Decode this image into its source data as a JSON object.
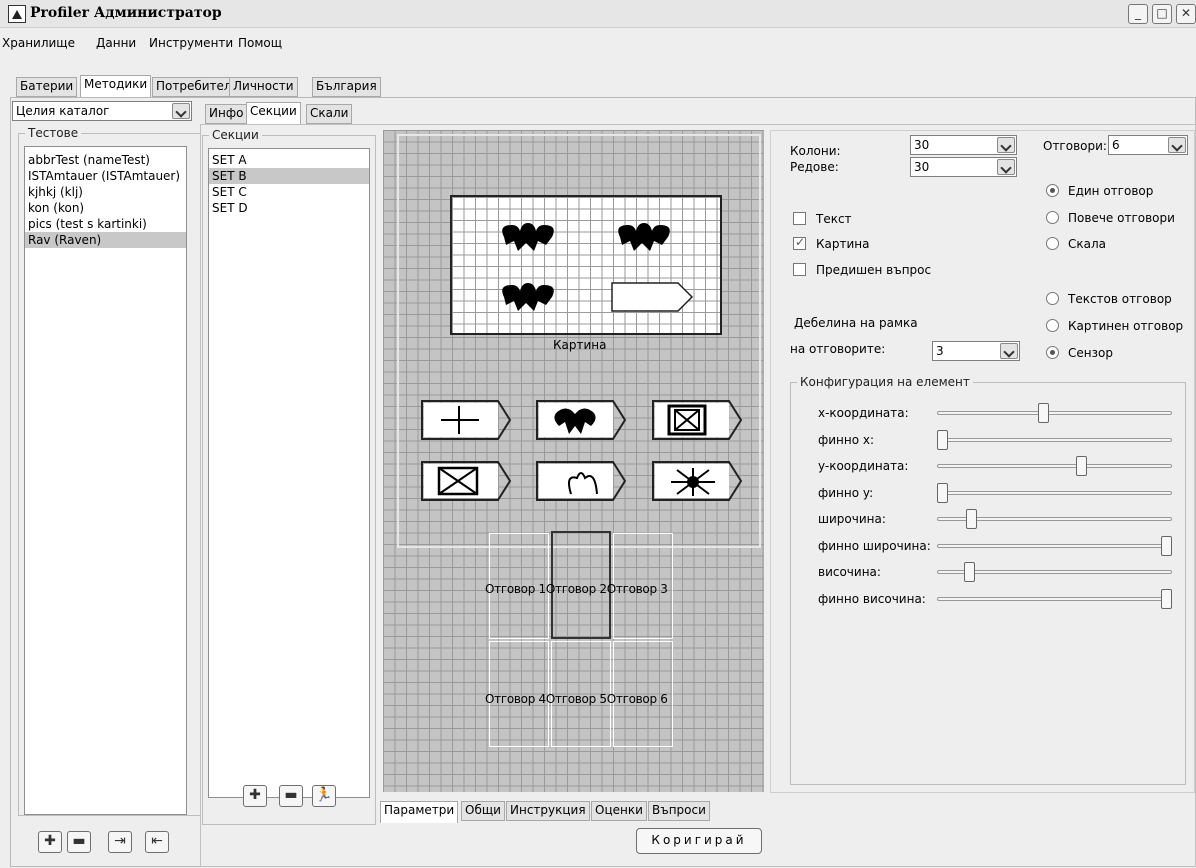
{
  "window": {
    "title": "Profiler Администратор"
  },
  "menu": [
    "Хранилище",
    "Данни",
    "Инструменти",
    "Помощ"
  ],
  "main_tabs": [
    "Батерии",
    "Методики",
    "Потребители",
    "Личности",
    "България"
  ],
  "left": {
    "catalog_select": "Целия каталог",
    "tests_label": "Тестове",
    "tests": [
      "abbrTest (nameTest)",
      "ISTAmtauer (ISTAmtauer)",
      "kjhkj (klj)",
      "kon (kon)",
      "pics (test s kartinki)",
      "Rav (Raven)"
    ]
  },
  "sub_tabs": [
    "Инфо",
    "Секции",
    "Скали"
  ],
  "sections": {
    "label": "Секции",
    "items": [
      "SET A",
      "SET B",
      "SET C",
      "SET D"
    ]
  },
  "canvas": {
    "picture_label": "Картина",
    "answers": [
      "Отговор 1",
      "Отговор 2",
      "Отговор 3",
      "Отговор 4",
      "Отговор 5",
      "Отговор 6"
    ]
  },
  "bottom_tabs": [
    "Параметри",
    "Общи",
    "Инструкция",
    "Оценки",
    "Въпроси"
  ],
  "right": {
    "columns_label": "Колони:",
    "columns_value": "30",
    "rows_label": "Редове:",
    "rows_value": "30",
    "answers_label": "Отговори:",
    "answers_value": "6",
    "single_answer": "Един отговор",
    "multi_answers": "Повече отговори",
    "scale": "Скала",
    "text_cb": "Текст",
    "picture_cb": "Картина",
    "prev_question_cb": "Предишен въпрос",
    "text_answer": "Текстов отговор",
    "picture_answer": "Картинен отговор",
    "sensor": "Сензор",
    "border_label_1": "Дебелина на рамка",
    "border_label_2": "на отговорите:",
    "border_value": "3",
    "config_label": "Конфигурация на елемент",
    "sliders": [
      {
        "label": "x-координата:",
        "value": 0.45
      },
      {
        "label": "финно x:",
        "value": 0.0
      },
      {
        "label": "y-координата:",
        "value": 0.62
      },
      {
        "label": "финно y:",
        "value": 0.0
      },
      {
        "label": "широчина:",
        "value": 0.13
      },
      {
        "label": "финно широчина:",
        "value": 1.0
      },
      {
        "label": "височина:",
        "value": 0.12
      },
      {
        "label": "финно височина:",
        "value": 1.0
      }
    ]
  },
  "correct_button": "Коригирай"
}
